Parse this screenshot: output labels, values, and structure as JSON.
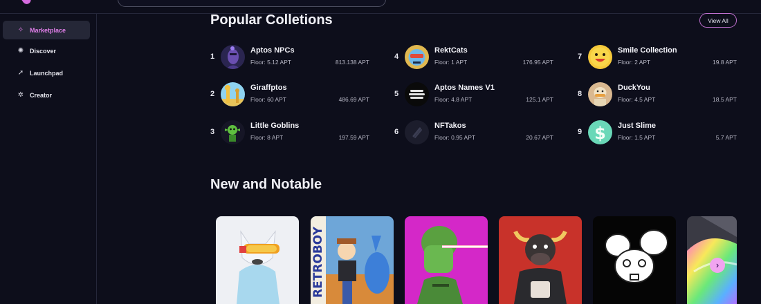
{
  "sidebar": {
    "items": [
      {
        "label": "Marketplace",
        "icon": "sparkle-icon",
        "active": true
      },
      {
        "label": "Discover",
        "icon": "compass-icon",
        "active": false
      },
      {
        "label": "Launchpad",
        "icon": "rocket-icon",
        "active": false
      },
      {
        "label": "Creator",
        "icon": "palette-icon",
        "active": false
      }
    ]
  },
  "popular": {
    "title": "Popular Colletions",
    "view_all_label": "View All",
    "collections": [
      {
        "rank": "1",
        "name": "Aptos NPCs",
        "floor": "Floor: 5.12 APT",
        "volume": "813.138 APT"
      },
      {
        "rank": "2",
        "name": "Giraffptos",
        "floor": "Floor: 60 APT",
        "volume": "486.69 APT"
      },
      {
        "rank": "3",
        "name": "Little Goblins",
        "floor": "Floor: 8 APT",
        "volume": "197.59 APT"
      },
      {
        "rank": "4",
        "name": "RektCats",
        "floor": "Floor: 1 APT",
        "volume": "176.95 APT"
      },
      {
        "rank": "5",
        "name": "Aptos Names V1",
        "floor": "Floor: 4.8 APT",
        "volume": "125.1 APT"
      },
      {
        "rank": "6",
        "name": "NFTakos",
        "floor": "Floor: 0.95 APT",
        "volume": "20.67 APT"
      },
      {
        "rank": "7",
        "name": "Smile Collection",
        "floor": "Floor: 2 APT",
        "volume": "19.8 APT"
      },
      {
        "rank": "8",
        "name": "DuckYou",
        "floor": "Floor: 4.5 APT",
        "volume": "18.5 APT"
      },
      {
        "rank": "9",
        "name": "Just Slime",
        "floor": "Floor: 1.5 APT",
        "volume": "5.7 APT"
      }
    ]
  },
  "notable": {
    "title": "New and Notable",
    "cards": [
      {
        "image": "white-wolf-with-goggles"
      },
      {
        "image": "retroboy-cartoon",
        "label": "RETROBOY"
      },
      {
        "image": "green-laser-eyes-character"
      },
      {
        "image": "bull-basketball-player"
      },
      {
        "image": "white-mouse-face"
      },
      {
        "image": "rainbow-unicorn"
      }
    ],
    "next_icon": "chevron-right-icon"
  },
  "colors": {
    "background": "#0d0e1b",
    "accent": "#e07ee8",
    "border": "#25273a"
  }
}
